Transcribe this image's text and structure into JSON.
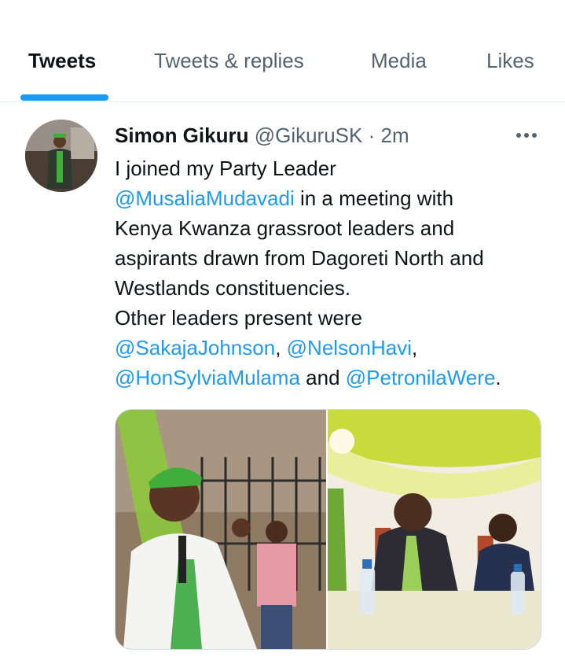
{
  "tabs": [
    {
      "label": "Tweets",
      "active": true
    },
    {
      "label": "Tweets & replies",
      "active": false
    },
    {
      "label": "Media",
      "active": false
    },
    {
      "label": "Likes",
      "active": false
    }
  ],
  "tweet": {
    "author_name": "Simon Gikuru",
    "author_handle": "@GikuruSK",
    "separator": "·",
    "time": "2m",
    "text": {
      "l1": "I joined my Party Leader",
      "m1": "@MusaliaMudavadi",
      "l2_rest": " in a meeting with",
      "l3": "Kenya Kwanza grassroot leaders and",
      "l4": "aspirants drawn from Dagoreti North and",
      "l5": "Westlands constituencies.",
      "l6": "Other leaders present were",
      "m2": "@SakajaJohnson",
      "c1": ", ",
      "m3": "@NelsonHavi",
      "c2": ",",
      "m4": "@HonSylviaMulama",
      "and": " and ",
      "m5": "@PetronilaWere",
      "end": "."
    }
  },
  "colors": {
    "accent": "#1d9bf0",
    "text_primary": "#0f1419",
    "text_secondary": "#536471",
    "divider": "#e7ecef"
  },
  "icons": {
    "more": "more-horizontal-icon"
  }
}
